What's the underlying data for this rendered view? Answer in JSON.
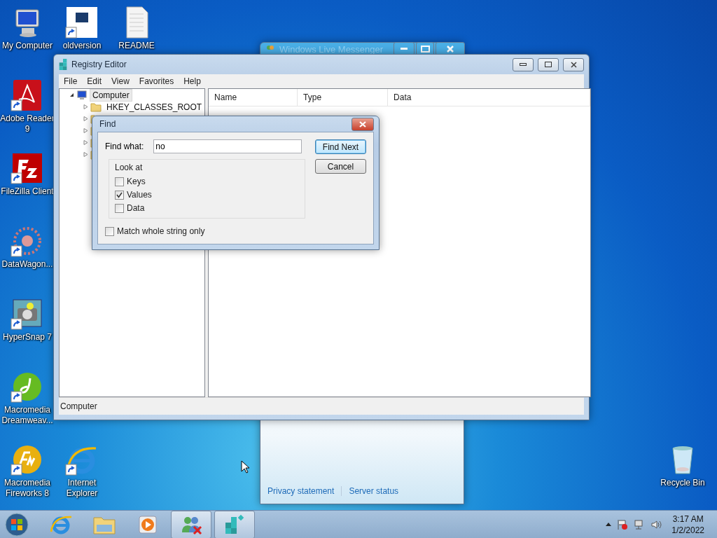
{
  "desktop_icons": [
    {
      "label": "My Computer",
      "kind": "computer",
      "shortcut": false
    },
    {
      "label": "oldversion",
      "kind": "ov",
      "shortcut": true
    },
    {
      "label": "README",
      "kind": "textfile",
      "shortcut": false
    },
    {
      "label": "Adobe Reader 9",
      "kind": "pdf",
      "shortcut": true
    },
    {
      "label": "FileZilla Client",
      "kind": "filezilla",
      "shortcut": true
    },
    {
      "label": "DataWagon...",
      "kind": "datawagon",
      "shortcut": true
    },
    {
      "label": "HyperSnap 7",
      "kind": "camera",
      "shortcut": true
    },
    {
      "label": "Macromedia Dreamweav...",
      "kind": "dreamweaver",
      "shortcut": true
    },
    {
      "label": "Macromedia Fireworks 8",
      "kind": "fireworks",
      "shortcut": true
    },
    {
      "label": "Internet Explorer",
      "kind": "ie",
      "shortcut": true
    },
    {
      "label": "Recycle Bin",
      "kind": "recycle",
      "shortcut": false
    }
  ],
  "messenger": {
    "title": "Windows Live Messenger",
    "links": [
      "Privacy statement",
      "Server status"
    ]
  },
  "registry_editor": {
    "title": "Registry Editor",
    "menu": [
      "File",
      "Edit",
      "View",
      "Favorites",
      "Help"
    ],
    "tree": {
      "label": "Computer",
      "expanded": true,
      "selected": true,
      "children": [
        {
          "label": "HKEY_CLASSES_ROOT",
          "expanded": false
        },
        {
          "expanded": false
        },
        {
          "expanded": false
        },
        {
          "expanded": false
        },
        {
          "expanded": false
        }
      ]
    },
    "columns": [
      "Name",
      "Type",
      "Data"
    ],
    "status_bar": "Computer"
  },
  "find_dialog": {
    "title": "Find",
    "find_what_label": "Find what:",
    "find_what_value": "no",
    "look_at_label": "Look at",
    "look_at": [
      {
        "label": "Keys",
        "checked": false
      },
      {
        "label": "Values",
        "checked": true
      },
      {
        "label": "Data",
        "checked": false
      }
    ],
    "match_whole": {
      "label": "Match whole string only",
      "checked": false
    },
    "buttons": [
      {
        "label": "Find Next",
        "default": true
      },
      {
        "label": "Cancel",
        "default": false
      }
    ]
  },
  "taskbar": {
    "items": [
      {
        "kind": "ie",
        "active": false
      },
      {
        "kind": "explorer",
        "active": false
      },
      {
        "kind": "media",
        "active": false
      },
      {
        "kind": "messenger",
        "active": true
      },
      {
        "kind": "regedit",
        "active": true
      }
    ],
    "time": "3:17 AM",
    "date": "1/2/2022"
  }
}
